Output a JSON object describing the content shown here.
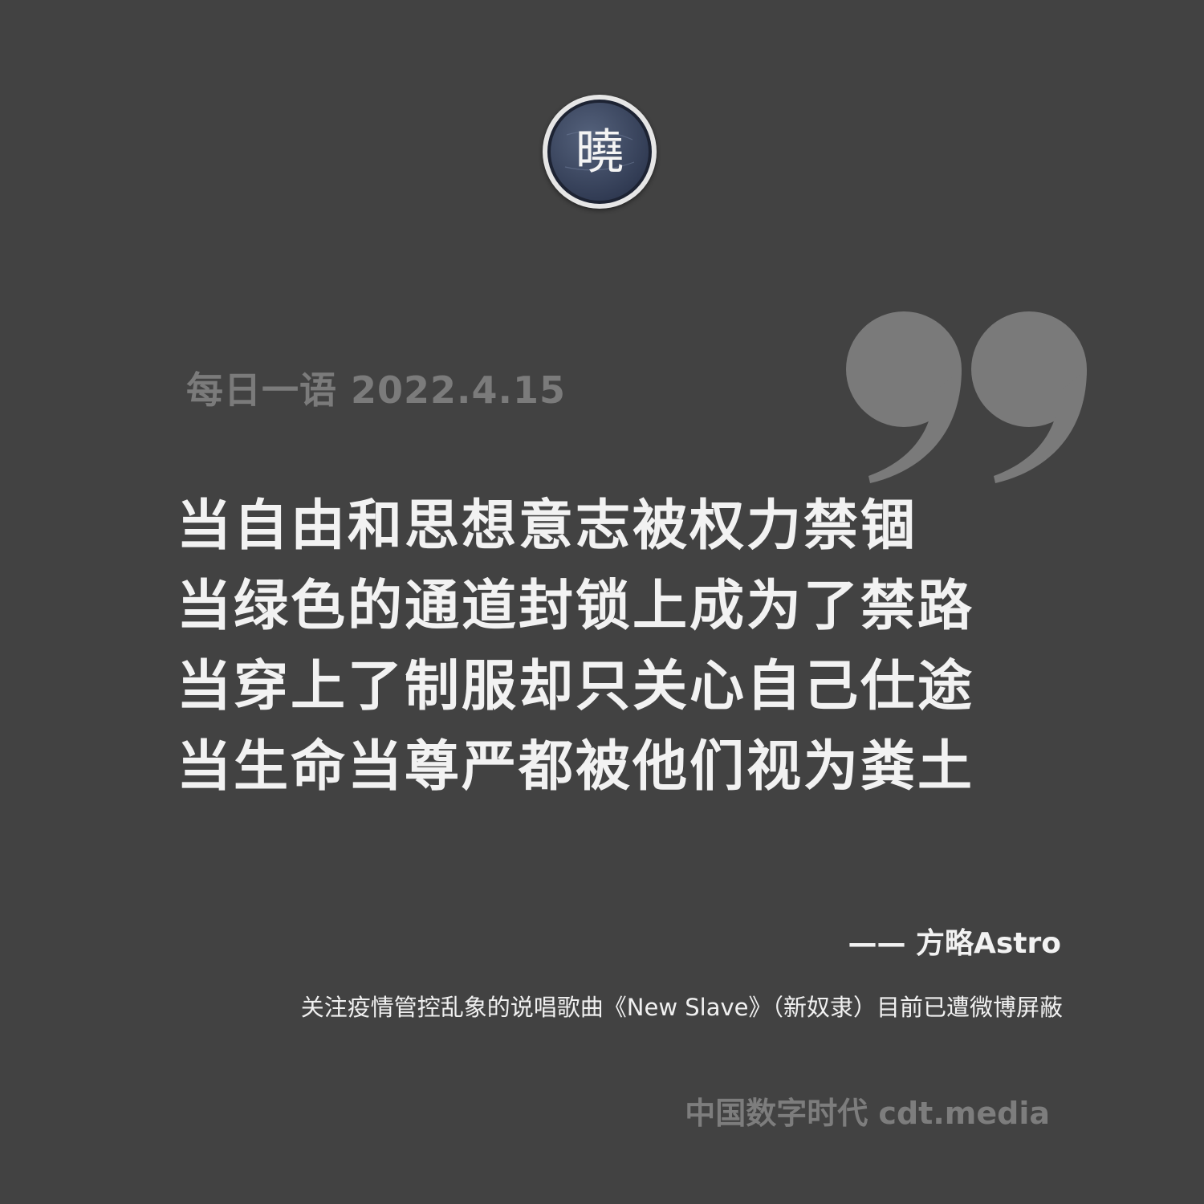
{
  "header": {
    "logo_glyph": "曉",
    "logo_icon": "cdt-seal-logo-icon",
    "quote_icon": "closing-quote-icon",
    "date_line": "每日一语 2022.4.15"
  },
  "quote": {
    "lines": [
      "当自由和思想意志被权力禁锢",
      "当绿色的通道封锁上成为了禁路",
      "当穿上了制服却只关心自己仕途",
      "当生命当尊严都被他们视为粪土"
    ]
  },
  "attribution": {
    "author": "—— 方略Astro",
    "note": "关注疫情管控乱象的说唱歌曲《New Slave》（新奴隶）目前已遭微博屏蔽"
  },
  "footer": {
    "brand": "中国数字时代 cdt.media"
  },
  "colors": {
    "background": "#424242",
    "lyric_text": "#f2f2f2",
    "muted_text": "#7b7b7b",
    "quote_mark": "#7a7a7a",
    "logo_ring": "#dedede",
    "logo_fill": "#3a4660"
  }
}
